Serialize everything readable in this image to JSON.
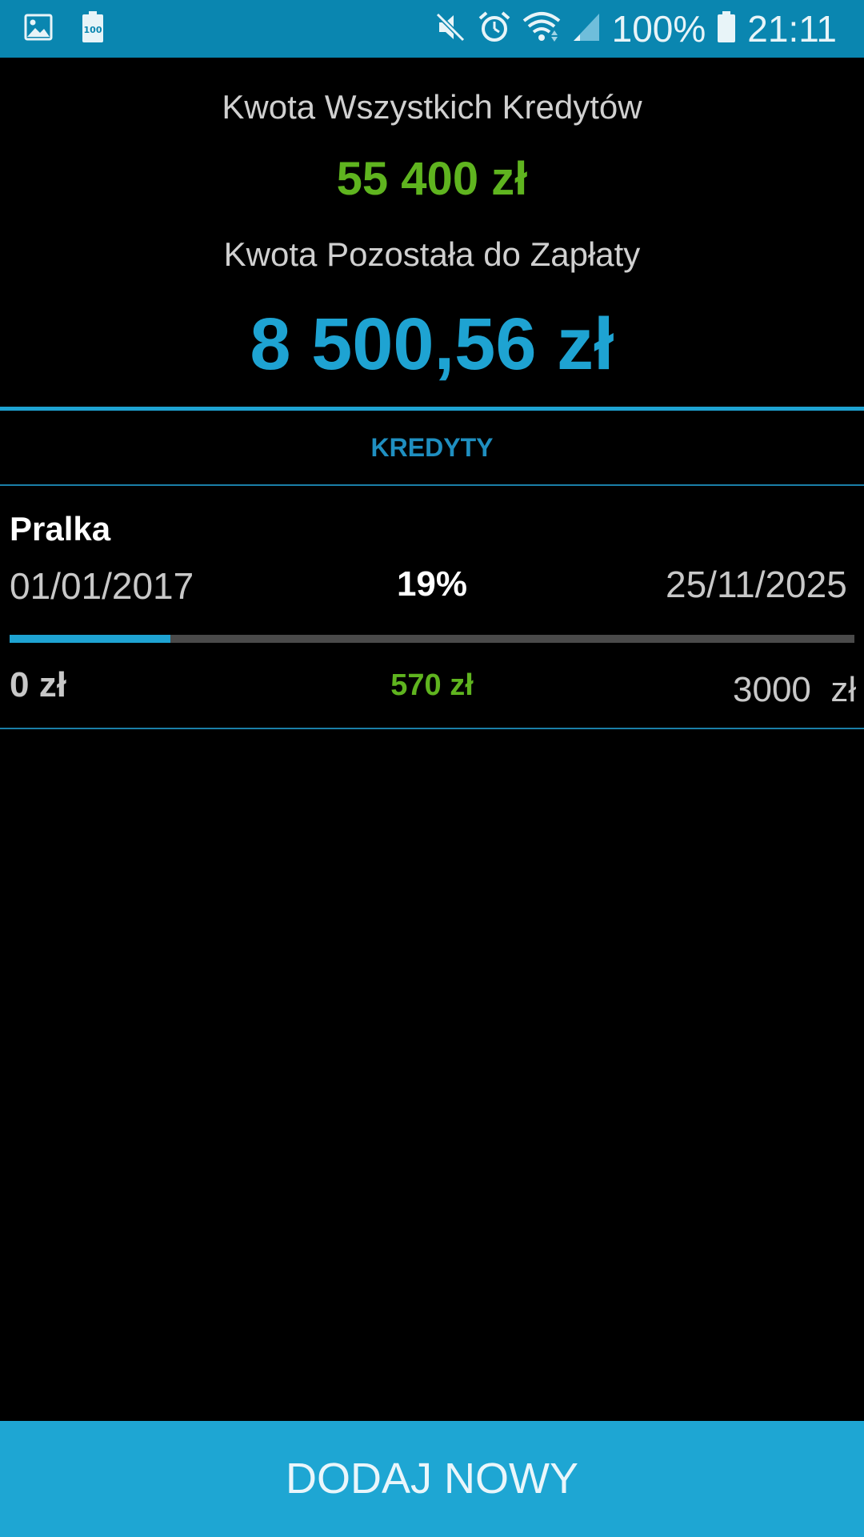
{
  "status_bar": {
    "left_icons": [
      "image-icon",
      "battery-100-icon"
    ],
    "right_icons": [
      "mute-icon",
      "alarm-icon",
      "wifi-icon",
      "signal-icon",
      "battery-icon"
    ],
    "battery_text": "100%",
    "time": "21:11"
  },
  "summary": {
    "total_label": "Kwota Wszystkich Kredytów",
    "total_value": "55 400 zł",
    "remaining_label": "Kwota Pozostała do Zapłaty",
    "remaining_value": "8 500,56 zł"
  },
  "section": {
    "title": "KREDYTY"
  },
  "credits": [
    {
      "name": "Pralka",
      "start_date": "01/01/2017",
      "percent": "19%",
      "end_date": "25/11/2025",
      "progress": 0.19,
      "min_amount": "0 zł",
      "paid_amount": "570 zł",
      "max_amount": "3000  zł"
    }
  ],
  "actions": {
    "add_new_label": "DODAJ NOWY"
  },
  "colors": {
    "status_bar": "#0a86b0",
    "accent_blue": "#1ea3d2",
    "accent_green": "#5fb41f",
    "button": "#1ea6d3",
    "background": "#000000"
  }
}
